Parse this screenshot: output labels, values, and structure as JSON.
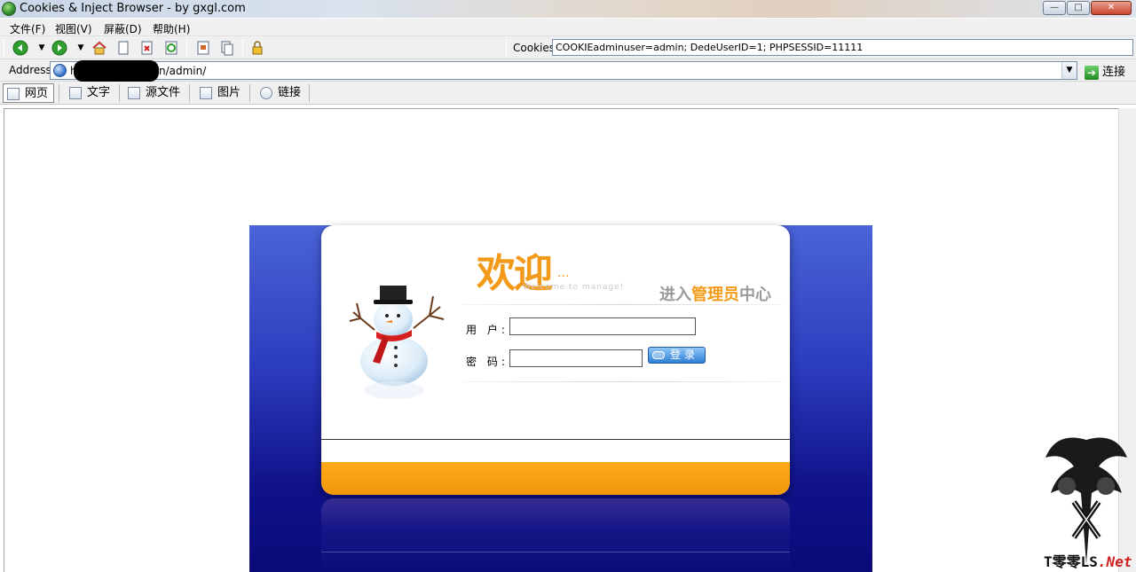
{
  "window": {
    "title": "Cookies & Inject Browser - by gxgl.com",
    "controls": {
      "minimize": "—",
      "maximize": "□",
      "close": "✕"
    }
  },
  "menu": [
    "文件(F)",
    "视图(V)",
    "屏蔽(D)",
    "帮助(H)"
  ],
  "toolbar": {
    "icons": [
      "back-icon",
      "dropdown-arrow",
      "forward-icon",
      "dropdown-arrow",
      "home-icon",
      "new-page-icon",
      "stop-icon",
      "refresh-icon",
      "save-icon",
      "copy-icon",
      "lock-icon"
    ],
    "cookies_label": "Cookies:",
    "cookies_value": "COOKIEadminuser=admin; DedeUserID=1; PHPSESSID=11111"
  },
  "address": {
    "label": "Address:",
    "prefix": "h",
    "url_visible": "n/admin/",
    "go_label": "连接"
  },
  "view_tabs": [
    {
      "label": "网页",
      "icon": "webpage-icon",
      "active": true
    },
    {
      "label": "文字",
      "icon": "text-icon",
      "active": false
    },
    {
      "label": "源文件",
      "icon": "source-icon",
      "active": false
    },
    {
      "label": "图片",
      "icon": "image-icon",
      "active": false
    },
    {
      "label": "链接",
      "icon": "link-icon",
      "active": false
    }
  ],
  "login": {
    "welcome": "欢迎",
    "welcome_dots": "...",
    "welcome_sub": "Welcome to manage!",
    "title_prefix": "进入",
    "title_highlight": "管理员",
    "title_suffix": "中心",
    "user_label": "用 户:",
    "pass_label": "密 码:",
    "user_value": "",
    "pass_value": "",
    "submit_label": "登录",
    "colors": {
      "accent": "#f39a1a",
      "panel_top": "#4a64d6",
      "panel_bottom": "#0a0a78",
      "button": "#2f7fd6"
    }
  },
  "watermark": {
    "prefix": "T",
    "middle": "零零LS",
    "suffix": ".Net"
  }
}
